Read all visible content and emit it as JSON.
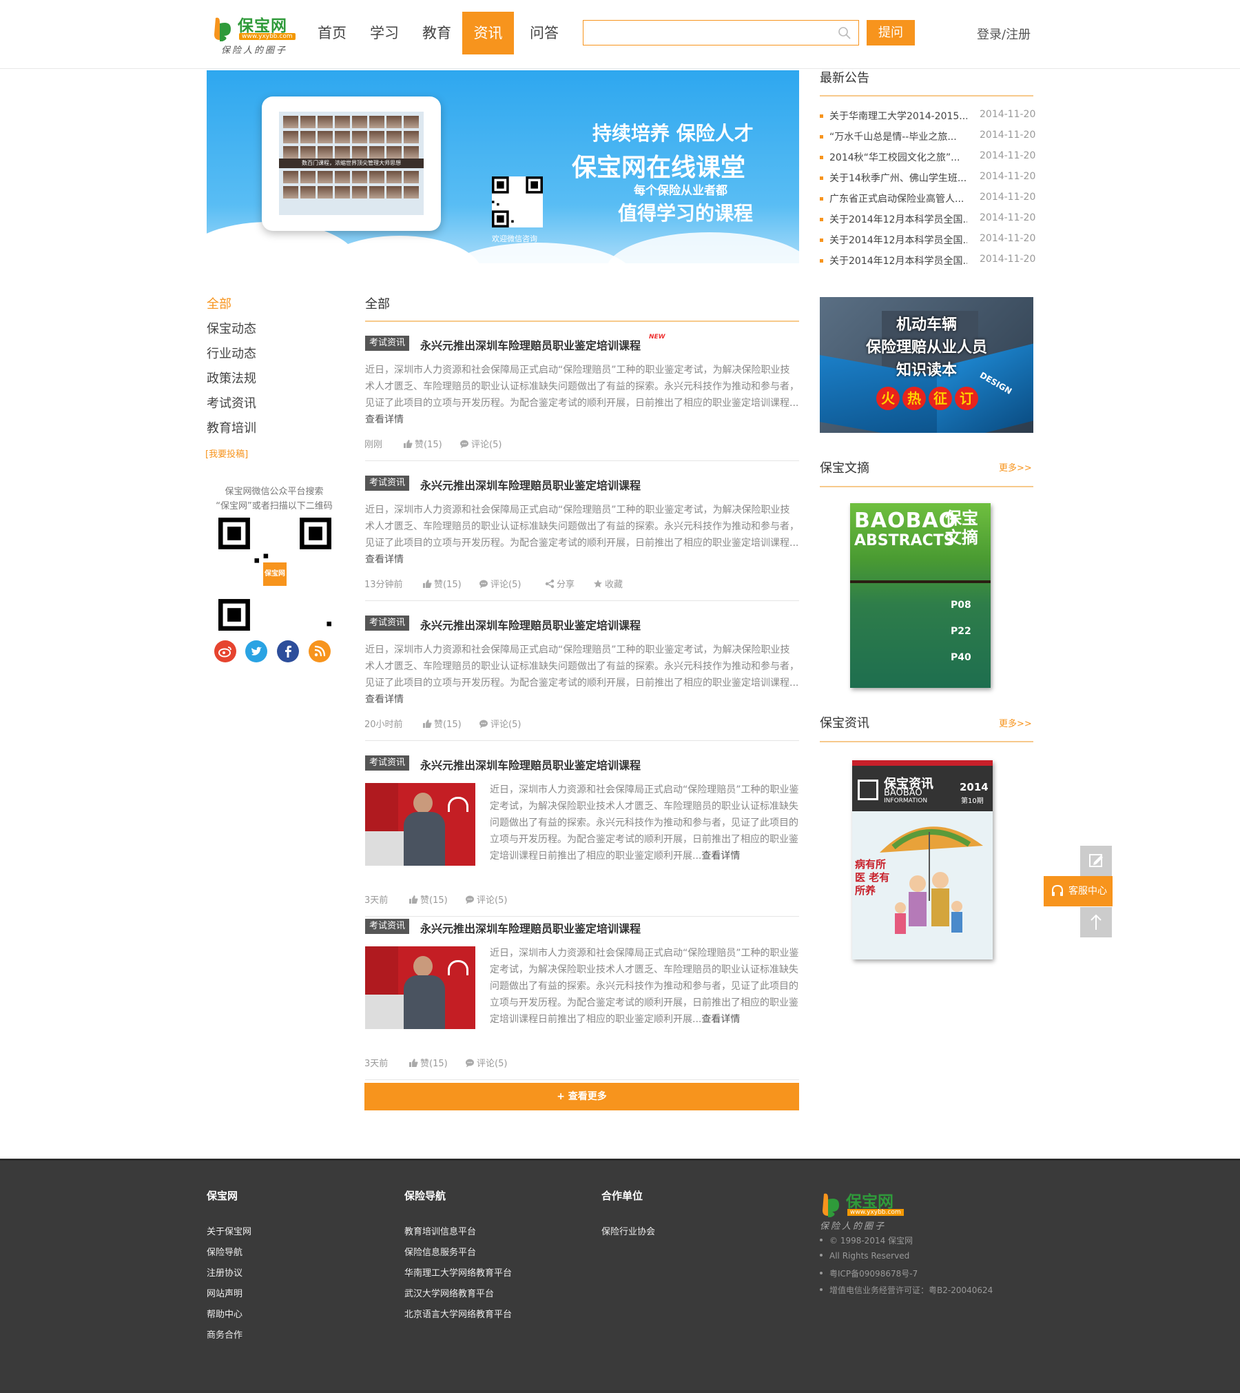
{
  "header": {
    "logo": {
      "name": "保宝网",
      "url": "www.yxybb.com",
      "slogan": "保险人的圈子"
    },
    "nav": [
      "首页",
      "学习",
      "教育",
      "资讯",
      "问答"
    ],
    "nav_active": "资讯",
    "search": {
      "value": "",
      "placeholder": ""
    },
    "ask_label": "提问",
    "login_label": "登录/注册"
  },
  "banner": {
    "line1": "持续培养 保险人才",
    "line2": "保宝网在线课堂",
    "line3": "每个保险从业者都",
    "line4": "值得学习的课程",
    "qr_caption": "欢迎微信咨询",
    "tablet_caption": "数百门课程，浓缩世界顶尖管理大师思想"
  },
  "notice": {
    "title": "最新公告",
    "items": [
      {
        "text": "关于华南理工大学2014-2015...",
        "date": "2014-11-20"
      },
      {
        "text": "“万水千山总是情--毕业之旅...",
        "date": "2014-11-20"
      },
      {
        "text": "2014秋“华工校园文化之旅”...",
        "date": "2014-11-20"
      },
      {
        "text": "关于14秋季广州、佛山学生班...",
        "date": "2014-11-20"
      },
      {
        "text": "广东省正式启动保险业高管人...",
        "date": "2014-11-20"
      },
      {
        "text": "关于2014年12月本科学员全国...",
        "date": "2014-11-20"
      },
      {
        "text": "关于2014年12月本科学员全国...",
        "date": "2014-11-20"
      },
      {
        "text": "关于2014年12月本科学员全国...",
        "date": "2014-11-20"
      }
    ]
  },
  "sidebar": {
    "categories": [
      "全部",
      "保宝动态",
      "行业动态",
      "政策法规",
      "考试资讯",
      "教育培训"
    ],
    "contribute": "[我要投稿]",
    "wechat_line1": "保宝网微信公众平台搜索",
    "wechat_line2": "“保宝网”或者扫描以下二维码",
    "social": [
      "weibo-icon",
      "twitter-icon",
      "facebook-icon",
      "rss-icon"
    ]
  },
  "main": {
    "title": "全部",
    "articles": [
      {
        "tag": "考试资讯",
        "title": "永兴元推出深圳车险理赔员职业鉴定培训课程",
        "badge": "NEW",
        "body": "近日，深圳市人力资源和社会保障局正式启动“保险理赔员”工种的职业鉴定考试，为解决保险职业技术人才匮乏、车险理赔员的职业认证标准缺失问题做出了有益的探索。永兴元科技作为推动和参与者，见证了此项目的立项与开发历程。为配合鉴定考试的顺利开展，日前推出了相应的职业鉴定培训课程...",
        "more": "查看详情",
        "time": "刚刚",
        "likes": "赞(15)",
        "comments": "评论(5)"
      },
      {
        "tag": "考试资讯",
        "title": "永兴元推出深圳车险理赔员职业鉴定培训课程",
        "body": "近日，深圳市人力资源和社会保障局正式启动“保险理赔员”工种的职业鉴定考试，为解决保险职业技术人才匮乏、车险理赔员的职业认证标准缺失问题做出了有益的探索。永兴元科技作为推动和参与者，见证了此项目的立项与开发历程。为配合鉴定考试的顺利开展，日前推出了相应的职业鉴定培训课程...",
        "more": "查看详情",
        "time": "13分钟前",
        "likes": "赞(15)",
        "comments": "评论(5)",
        "share": "分享",
        "fav": "收藏"
      },
      {
        "tag": "考试资讯",
        "title": "永兴元推出深圳车险理赔员职业鉴定培训课程",
        "body": "近日，深圳市人力资源和社会保障局正式启动“保险理赔员”工种的职业鉴定考试，为解决保险职业技术人才匮乏、车险理赔员的职业认证标准缺失问题做出了有益的探索。永兴元科技作为推动和参与者，见证了此项目的立项与开发历程。为配合鉴定考试的顺利开展，日前推出了相应的职业鉴定培训课程...",
        "more": "查看详情",
        "time": "20小时前",
        "likes": "赞(15)",
        "comments": "评论(5)"
      },
      {
        "tag": "考试资讯",
        "title": "永兴元推出深圳车险理赔员职业鉴定培训课程",
        "body": "近日，深圳市人力资源和社会保障局正式启动“保险理赔员”工种的职业鉴定考试，为解决保险职业技术人才匮乏、车险理赔员的职业认证标准缺失问题做出了有益的探索。永兴元科技作为推动和参与者，见证了此项目的立项与开发历程。为配合鉴定考试的顺利开展，日前推出了相应的职业鉴定培训课程日前推出了相应的职业鉴定顺利开展...",
        "more": "查看详情",
        "time": "3天前",
        "likes": "赞(15)",
        "comments": "评论(5)"
      },
      {
        "tag": "考试资讯",
        "title": "永兴元推出深圳车险理赔员职业鉴定培训课程",
        "body": "近日，深圳市人力资源和社会保障局正式启动“保险理赔员”工种的职业鉴定考试，为解决保险职业技术人才匮乏、车险理赔员的职业认证标准缺失问题做出了有益的探索。永兴元科技作为推动和参与者，见证了此项目的立项与开发历程。为配合鉴定考试的顺利开展，日前推出了相应的职业鉴定培训课程日前推出了相应的职业鉴定顺利开展...",
        "more": "查看详情",
        "time": "3天前",
        "likes": "赞(15)",
        "comments": "评论(5)"
      }
    ],
    "load_more": "+ 查看更多"
  },
  "right": {
    "ad": {
      "line1": "机动车辆",
      "line2": "保险理赔从业人员",
      "line3": "知识读本",
      "cta": [
        "火",
        "热",
        "征",
        "订"
      ],
      "design": "DESIGN"
    },
    "digest": {
      "title": "保宝文摘",
      "more": "更多>>",
      "cover_en1": "BAOBAO",
      "cover_en2": "ABSTRACTS",
      "cover_cn": "保宝文摘",
      "pages": [
        "P08",
        "P22",
        "P40"
      ]
    },
    "info": {
      "title": "保宝资讯",
      "more": "更多>>",
      "cover_cn": "保宝资讯",
      "cover_en1": "BAOBAO",
      "cover_en2": "INFORMATION",
      "year": "2014",
      "issue": "第10期",
      "headline": "病有所医 老有所养"
    }
  },
  "float": {
    "service": "客服中心"
  },
  "footer": {
    "col1": {
      "title": "保宝网",
      "links": [
        "关于保宝网",
        "保险导航",
        "注册协议",
        "网站声明",
        "帮助中心",
        "商务合作"
      ]
    },
    "col2": {
      "title": "保险导航",
      "links": [
        "教育培训信息平台",
        "保险信息服务平台",
        "华南理工大学网络教育平台",
        "武汉大学网络教育平台",
        "北京语言大学网络教育平台"
      ]
    },
    "col3": {
      "title": "合作单位",
      "links": [
        "保险行业协会"
      ]
    },
    "info": [
      "© 1998-2014 保宝网",
      "All Rights Reserved",
      "粤ICP备09098678号-7",
      "增值电信业务经营许可证：粤B2-20040624"
    ]
  },
  "colors": {
    "accent": "#f7941d",
    "brand_green": "#2f9a3a",
    "footer_bg": "#3a3a3a"
  }
}
